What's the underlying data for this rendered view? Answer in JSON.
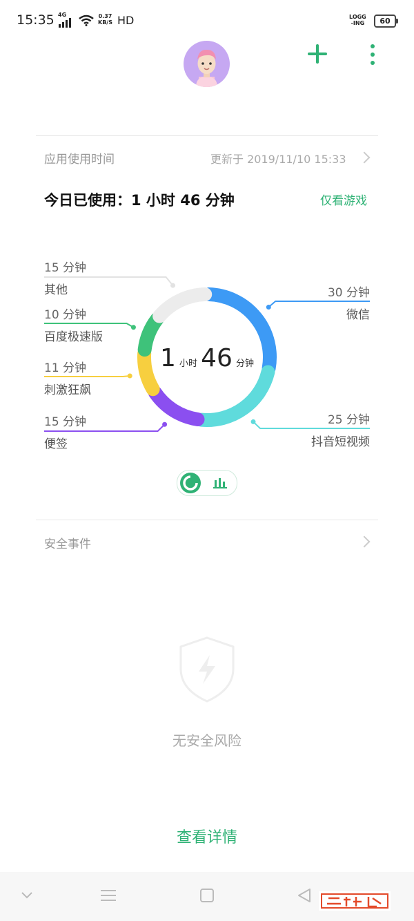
{
  "status_bar": {
    "time": "15:35",
    "network": "4G",
    "speed_value": "0.37",
    "speed_unit": "KB/S",
    "hd": "HD",
    "logging_top": "LOGG",
    "logging_bottom": "-ING",
    "battery": "60"
  },
  "header": {
    "avatar_icon": "avatar-icon",
    "add_icon": "plus-icon",
    "more_icon": "more-vertical-icon"
  },
  "usage": {
    "section_title": "应用使用时间",
    "updated_text": "更新于 2019/11/10 15:33",
    "today_label": "今日已使用：1 小时 46 分钟",
    "games_only_link": "仅看游戏",
    "total": {
      "hours": "1",
      "hours_unit": "小时",
      "minutes": "46",
      "minutes_unit": "分钟"
    },
    "apps": [
      {
        "name": "微信",
        "duration": "30 分钟",
        "minutes": 30,
        "color": "#3d9af5"
      },
      {
        "name": "抖音短视频",
        "duration": "25 分钟",
        "minutes": 25,
        "color": "#5fdbdc"
      },
      {
        "name": "便签",
        "duration": "15 分钟",
        "minutes": 15,
        "color": "#8b4ff0"
      },
      {
        "name": "刺激狂飙",
        "duration": "11 分钟",
        "minutes": 11,
        "color": "#f7cf3f"
      },
      {
        "name": "百度极速版",
        "duration": "10 分钟",
        "minutes": 10,
        "color": "#3ec27a"
      },
      {
        "name": "其他",
        "duration": "15 分钟",
        "minutes": 15,
        "color": "#ececec"
      }
    ],
    "view_toggle": {
      "selected": "ring-chart",
      "options": [
        "ring-chart-icon",
        "bar-chart-icon"
      ]
    }
  },
  "security": {
    "section_title": "安全事件",
    "status_text": "无安全风险",
    "shield_icon": "shield-bolt-icon"
  },
  "detail_link": "查看详情",
  "nav_bar": {
    "icons": [
      "chevron-down-icon",
      "menu-icon",
      "home-square-icon",
      "back-triangle-icon"
    ]
  },
  "colors": {
    "accent": "#2fb275"
  }
}
